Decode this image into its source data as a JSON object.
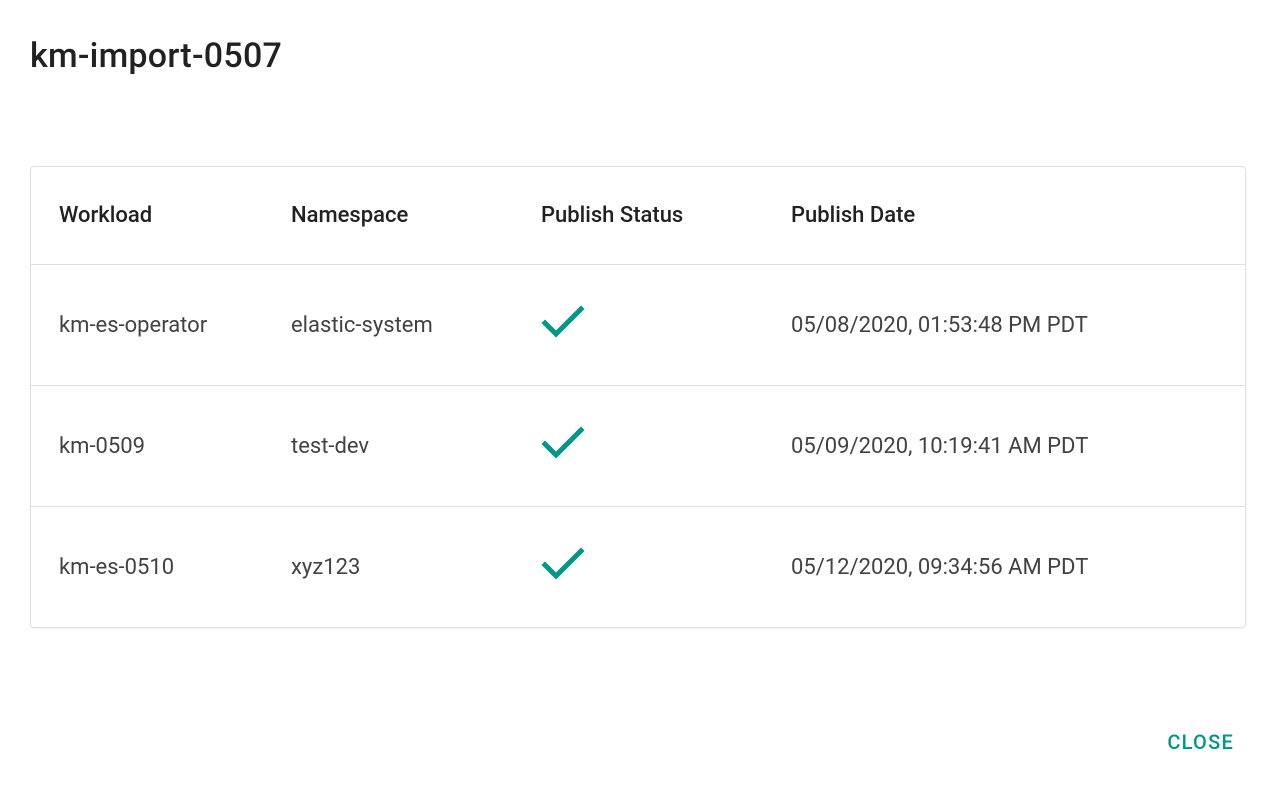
{
  "title": "km-import-0507",
  "columns": {
    "workload": "Workload",
    "namespace": "Namespace",
    "publish_status": "Publish Status",
    "publish_date": "Publish Date"
  },
  "rows": [
    {
      "workload": "km-es-operator",
      "namespace": "elastic-system",
      "status": "published",
      "date": "05/08/2020, 01:53:48 PM PDT"
    },
    {
      "workload": "km-0509",
      "namespace": "test-dev",
      "status": "published",
      "date": "05/09/2020, 10:19:41 AM PDT"
    },
    {
      "workload": "km-es-0510",
      "namespace": "xyz123",
      "status": "published",
      "date": "05/12/2020, 09:34:56 AM PDT"
    }
  ],
  "actions": {
    "close": "CLOSE"
  },
  "colors": {
    "accent": "#009688"
  }
}
